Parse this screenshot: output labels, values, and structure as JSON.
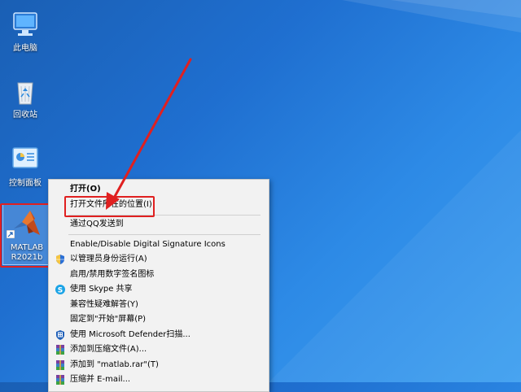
{
  "desktop": {
    "icons": [
      {
        "label": "此电脑",
        "icon": "computer-icon"
      },
      {
        "label": "回收站",
        "icon": "recycle-bin-icon"
      },
      {
        "label": "控制面板",
        "icon": "control-panel-icon"
      },
      {
        "label": "MATLAB\nR2021b",
        "icon": "matlab-icon"
      }
    ]
  },
  "context_menu": {
    "items": [
      {
        "label": "打开(O)",
        "icon": "",
        "bold": true
      },
      {
        "label": "打开文件所在的位置(I)",
        "icon": "",
        "highlighted": true
      },
      {
        "label": "通过QQ发送到",
        "icon": ""
      },
      {
        "label": "Enable/Disable Digital Signature Icons",
        "icon": ""
      },
      {
        "label": "以管理员身份运行(A)",
        "icon": "shield-icon"
      },
      {
        "label": "启用/禁用数字签名图标",
        "icon": ""
      },
      {
        "label": "使用 Skype 共享",
        "icon": "skype-icon"
      },
      {
        "label": "兼容性疑难解答(Y)",
        "icon": ""
      },
      {
        "label": "固定到\"开始\"屏幕(P)",
        "icon": ""
      },
      {
        "label": "使用 Microsoft Defender扫描...",
        "icon": "defender-icon"
      },
      {
        "label": "添加到压缩文件(A)...",
        "icon": "winrar-icon"
      },
      {
        "label": "添加到 \"matlab.rar\"(T)",
        "icon": "winrar-icon"
      },
      {
        "label": "压缩并 E-mail...",
        "icon": "winrar-icon"
      }
    ]
  },
  "colors": {
    "highlight_box": "#e02020",
    "arrow": "#e02020",
    "menu_bg": "#f2f2f2"
  }
}
